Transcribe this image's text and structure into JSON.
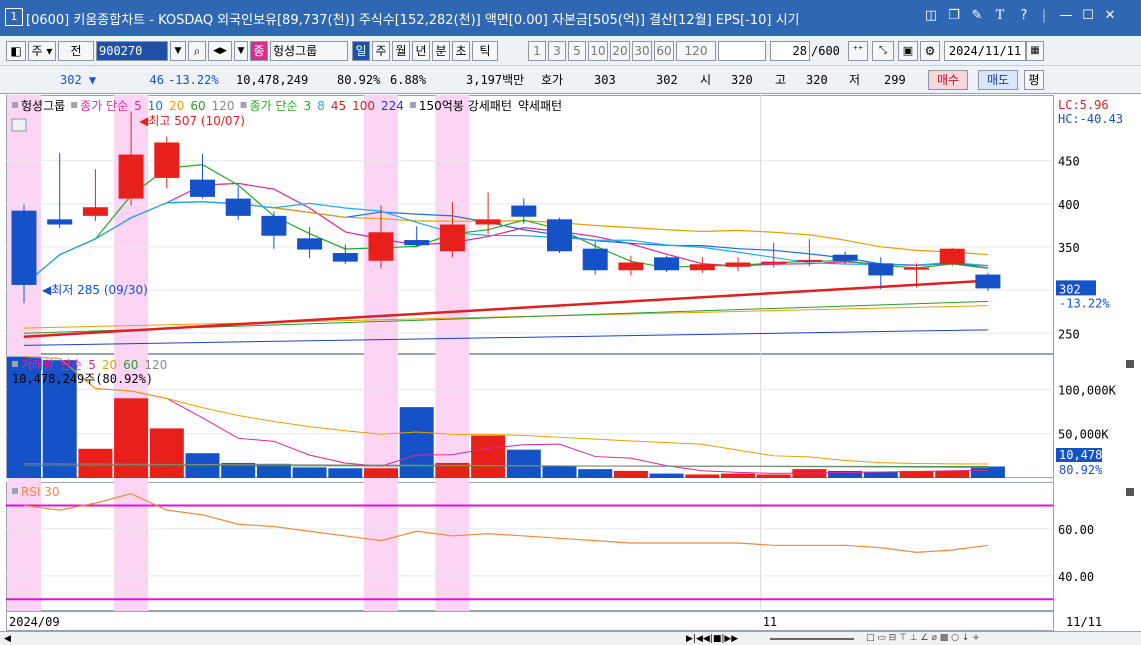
{
  "window": {
    "number": "1",
    "title": "[0600] 키움종합차트 - KOSDAQ 외국인보유[89,737(천)] 주식수[152,282(천)] 액면[0.00] 자본금[505(억)] 결산[12월] EPS[-10] 시기"
  },
  "toolbar": {
    "period_buttons": [
      "주",
      "전"
    ],
    "code_value": "900270",
    "group_label": "헝셩그룹",
    "timeframes": [
      "일",
      "주",
      "월",
      "년",
      "분",
      "초",
      "틱"
    ],
    "intervals": [
      "1",
      "3",
      "5",
      "10",
      "20",
      "30",
      "60",
      "120"
    ],
    "count_value": "28",
    "count_total": "/600",
    "date_value": "2024/11/11"
  },
  "quote": {
    "price": "302",
    "change": "46",
    "change_pct": "-13.22%",
    "volume": "10,478,249",
    "vol_ratio": "80.92%",
    "turnover": "6.88%",
    "amount": "3,197백만",
    "hoga_label": "호가",
    "hoga1": "303",
    "hoga2": "302",
    "open_label": "시",
    "open": "320",
    "high_label": "고",
    "high": "320",
    "low_label": "저",
    "low": "299",
    "buy_label": "매수",
    "sell_label": "매도",
    "avg_label": "평"
  },
  "price_panel": {
    "legend": [
      {
        "text": "헝셩그룹",
        "color": "#000000"
      },
      {
        "text": "종가 단순",
        "color": "#e0249b"
      },
      {
        "text": "5",
        "color": "#e0249b"
      },
      {
        "text": "10",
        "color": "#1e6fd9"
      },
      {
        "text": "20",
        "color": "#e8a000"
      },
      {
        "text": "60",
        "color": "#2c9a2c"
      },
      {
        "text": "120",
        "color": "#888888"
      },
      {
        "text": "종가 단순",
        "color": "#22aa22"
      },
      {
        "text": "3",
        "color": "#22aa22"
      },
      {
        "text": "8",
        "color": "#22aaee"
      },
      {
        "text": "45",
        "color": "#e02020"
      },
      {
        "text": "100",
        "color": "#e02020"
      },
      {
        "text": "224",
        "color": "#2040c0"
      },
      {
        "text": "150억봉 강세패턴",
        "color": "#000000"
      },
      {
        "text": "약세패턴",
        "color": "#000000"
      }
    ],
    "high_annotation": "최고 507 (10/07)",
    "low_annotation": "최저 285 (09/30)",
    "lc_label": "LC:5.96",
    "hc_label": "HC:-40.43",
    "last_price_tag": "302",
    "last_change_tag": "-13.22%"
  },
  "volume_panel": {
    "legend": [
      {
        "text": "거래량",
        "color": "#e0249b"
      },
      {
        "text": "단순",
        "color": "#e0249b"
      },
      {
        "text": "5",
        "color": "#e0249b"
      },
      {
        "text": "20",
        "color": "#e8a000"
      },
      {
        "text": "60",
        "color": "#2c9a2c"
      },
      {
        "text": "120",
        "color": "#888888"
      }
    ],
    "sub_label": "10,478,249주(80.92%)",
    "last_tag": "10,478K",
    "last_pct_tag": "80.92%"
  },
  "rsi_panel": {
    "legend": "RSI 30"
  },
  "x_axis": {
    "start_label": "2024/09",
    "mid_label": "11",
    "end_label": "11/11"
  },
  "chart_data": [
    {
      "type": "candlestick",
      "y_ticks": [
        450,
        400,
        350,
        300,
        250
      ],
      "ylim": [
        226,
        526
      ],
      "highlight_candles": [
        0,
        3,
        10,
        12
      ],
      "candles": [
        {
          "o": 392,
          "h": 399,
          "l": 285,
          "c": 306
        },
        {
          "o": 382,
          "h": 459,
          "l": 372,
          "c": 376
        },
        {
          "o": 386,
          "h": 440,
          "l": 380,
          "c": 396
        },
        {
          "o": 406,
          "h": 507,
          "l": 398,
          "c": 457
        },
        {
          "o": 430,
          "h": 478,
          "l": 418,
          "c": 471
        },
        {
          "o": 428,
          "h": 458,
          "l": 406,
          "c": 408
        },
        {
          "o": 406,
          "h": 420,
          "l": 381,
          "c": 386
        },
        {
          "o": 386,
          "h": 391,
          "l": 348,
          "c": 363
        },
        {
          "o": 360,
          "h": 373,
          "l": 337,
          "c": 347
        },
        {
          "o": 343,
          "h": 353,
          "l": 330,
          "c": 333
        },
        {
          "o": 334,
          "h": 398,
          "l": 325,
          "c": 367
        },
        {
          "o": 358,
          "h": 374,
          "l": 351,
          "c": 352
        },
        {
          "o": 345,
          "h": 402,
          "l": 338,
          "c": 376
        },
        {
          "o": 376,
          "h": 413,
          "l": 365,
          "c": 382
        },
        {
          "o": 398,
          "h": 406,
          "l": 377,
          "c": 385
        },
        {
          "o": 382,
          "h": 384,
          "l": 343,
          "c": 345
        },
        {
          "o": 348,
          "h": 356,
          "l": 318,
          "c": 323
        },
        {
          "o": 323,
          "h": 340,
          "l": 317,
          "c": 332
        },
        {
          "o": 338,
          "h": 340,
          "l": 321,
          "c": 323
        },
        {
          "o": 323,
          "h": 338,
          "l": 320,
          "c": 330
        },
        {
          "o": 327,
          "h": 338,
          "l": 322,
          "c": 332
        },
        {
          "o": 331,
          "h": 355,
          "l": 326,
          "c": 333
        },
        {
          "o": 333,
          "h": 359,
          "l": 328,
          "c": 335
        },
        {
          "o": 341,
          "h": 345,
          "l": 330,
          "c": 334
        },
        {
          "o": 331,
          "h": 338,
          "l": 301,
          "c": 317
        },
        {
          "o": 325,
          "h": 331,
          "l": 303,
          "c": 326
        },
        {
          "o": 330,
          "h": 349,
          "l": 328,
          "c": 348
        },
        {
          "o": 318,
          "h": 320,
          "l": 299,
          "c": 302
        }
      ]
    },
    {
      "type": "bar",
      "y_ticks": [
        "100,000K",
        "50,000K"
      ],
      "ylim": [
        0,
        140000
      ],
      "values_k": [
        137000,
        133000,
        33000,
        90000,
        56000,
        28000,
        17000,
        16000,
        12000,
        11000,
        11000,
        80000,
        17000,
        48000,
        32000,
        14000,
        10000,
        8000,
        5000,
        4000,
        5000,
        4000,
        10000,
        8000,
        7000,
        8000,
        8000,
        13000,
        10478
      ]
    },
    {
      "type": "line",
      "y_ticks": [
        "60.00",
        "40.00"
      ],
      "ylim": [
        25,
        80
      ],
      "levels": [
        70,
        30
      ],
      "values": [
        70,
        68,
        71,
        75,
        68,
        66,
        62,
        61,
        59,
        57,
        55,
        59,
        57,
        58,
        57,
        56,
        55,
        54,
        54,
        54,
        54,
        53,
        53,
        53,
        52,
        50,
        51,
        53,
        48
      ]
    }
  ]
}
